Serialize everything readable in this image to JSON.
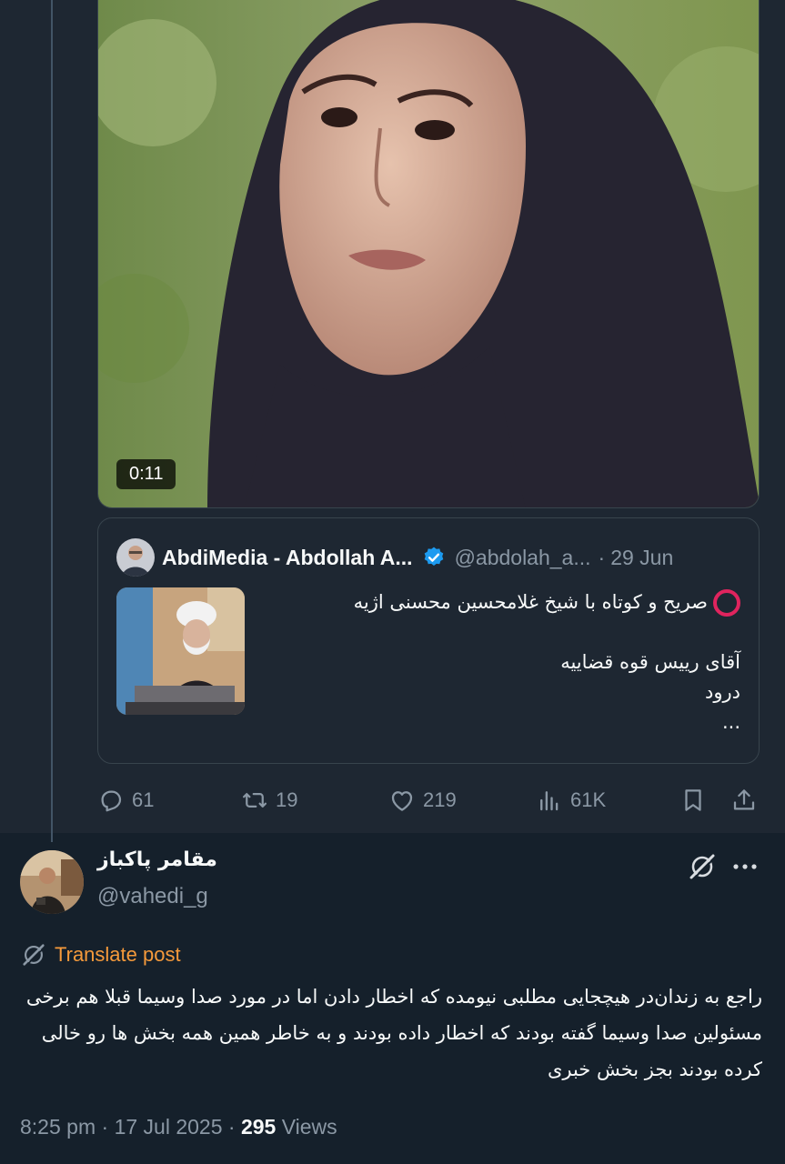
{
  "colors": {
    "background": "#15202b",
    "top_background": "#1e2732",
    "text_primary": "#f7f9f9",
    "text_secondary": "#8b98a5",
    "verified_blue": "#1d9bf0",
    "translate_orange": "#f59a3b",
    "circle_red": "#e0245e"
  },
  "video": {
    "duration": "0:11"
  },
  "quoted_post": {
    "display_name": "AbdiMedia - Abdollah A...",
    "verified_icon": "verified-badge-icon",
    "handle": "@abdolah_a...",
    "separator": "·",
    "date": "29 Jun",
    "text_lines": [
      "صریح و کوتاه با شیخ غلامحسین محسنی اژیه",
      "",
      "آقای رییس قوه قضاییه",
      "درود",
      "..."
    ]
  },
  "actions": {
    "replies": "61",
    "reposts": "19",
    "likes": "219",
    "views": "61K",
    "icons": [
      "reply-icon",
      "repost-icon",
      "like-icon",
      "views-icon",
      "bookmark-icon",
      "share-icon"
    ]
  },
  "reply_post": {
    "display_name": "مقامر پاکباز",
    "handle": "@vahedi_g",
    "translate_label": "Translate post",
    "body": "راجع به زندان‌در  هیچجایی مطلبی نیومده که اخطار دادن اما در مورد صدا وسیما قبلا هم برخی مسئولین صدا وسیما گفته بودند که اخطار داده بودند و به خاطر همین همه بخش ها رو خالی کرده بودند بجز بخش خبری",
    "time": "8:25 pm",
    "separator": "·",
    "date": "17 Jul 2025",
    "views_count": "295",
    "views_label": "Views"
  }
}
